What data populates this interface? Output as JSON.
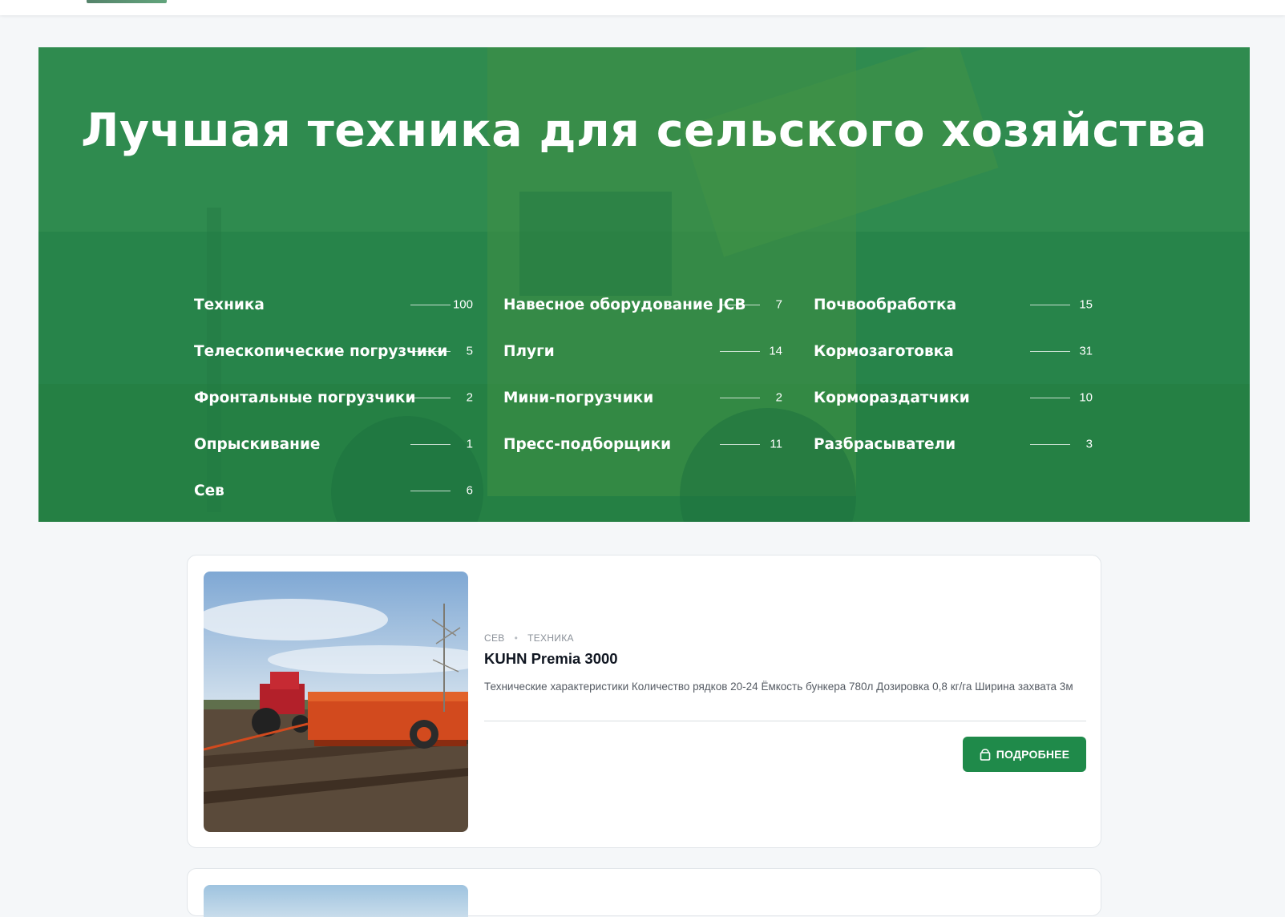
{
  "hero": {
    "title": "Лучшая техника для сельского хозяйства",
    "columns": [
      [
        {
          "label": "Техника",
          "count": "100"
        },
        {
          "label": "Телескопические погрузчики",
          "count": "5"
        },
        {
          "label": "Фронтальные погрузчики",
          "count": "2"
        },
        {
          "label": "Опрыскивание",
          "count": "1"
        },
        {
          "label": "Сев",
          "count": "6"
        }
      ],
      [
        {
          "label": "Навесное оборудование JCB",
          "count": "7"
        },
        {
          "label": "Плуги",
          "count": "14"
        },
        {
          "label": "Мини-погрузчики",
          "count": "2"
        },
        {
          "label": "Пресс-подборщики",
          "count": "11"
        }
      ],
      [
        {
          "label": "Почвообработка",
          "count": "15"
        },
        {
          "label": "Кормозаготовка",
          "count": "31"
        },
        {
          "label": "Кормораздатчики",
          "count": "10"
        },
        {
          "label": "Разбрасыватели",
          "count": "3"
        }
      ]
    ]
  },
  "product": {
    "tags": [
      "СЕВ",
      "ТЕХНИКА"
    ],
    "tag_separator": "•",
    "title": "KUHN Premia 3000",
    "description": "Технические характеристики Количество рядков 20-24 Ёмкость бункера 780л Дозировка 0,8 кг/га Ширина захвата 3м",
    "button_label": "ПОДРОБНЕЕ",
    "button_icon": "shopping-bag-icon"
  },
  "colors": {
    "accent": "#1f8a4a",
    "hero_overlay": "#1e8748"
  }
}
